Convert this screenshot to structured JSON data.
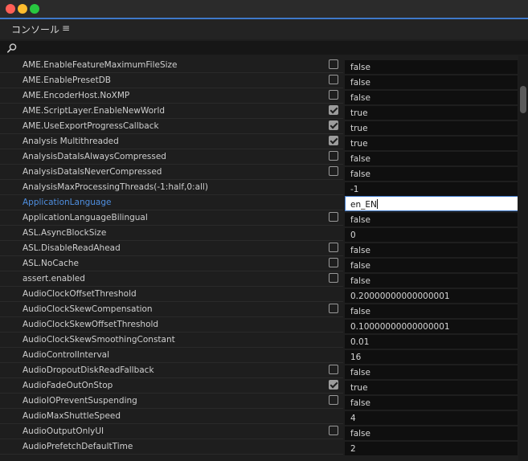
{
  "window": {
    "traffic_lights": [
      "close",
      "minimize",
      "maximize"
    ],
    "colors": {
      "close": "#ff5f57",
      "minimize": "#febc2e",
      "maximize": "#28c840",
      "accent": "#3f79c9",
      "selected_text": "#4f8fe0"
    }
  },
  "panel": {
    "title": "コンソール",
    "menu_icon": "hamburger-menu-icon",
    "menu_glyph": "≡"
  },
  "search": {
    "icon": "search-icon",
    "value": "",
    "placeholder": ""
  },
  "rows": [
    {
      "name": "AME.EnableFeatureMaximumFileSize",
      "type": "bool",
      "checked": false,
      "value": "false"
    },
    {
      "name": "AME.EnablePresetDB",
      "type": "bool",
      "checked": false,
      "value": "false"
    },
    {
      "name": "AME.EncoderHost.NoXMP",
      "type": "bool",
      "checked": false,
      "value": "false"
    },
    {
      "name": "AME.ScriptLayer.EnableNewWorld",
      "type": "bool",
      "checked": true,
      "value": "true"
    },
    {
      "name": "AME.UseExportProgressCallback",
      "type": "bool",
      "checked": true,
      "value": "true"
    },
    {
      "name": "Analysis Multithreaded",
      "type": "bool",
      "checked": true,
      "value": "true"
    },
    {
      "name": "AnalysisDataIsAlwaysCompressed",
      "type": "bool",
      "checked": false,
      "value": "false"
    },
    {
      "name": "AnalysisDataIsNeverCompressed",
      "type": "bool",
      "checked": false,
      "value": "false"
    },
    {
      "name": "AnalysisMaxProcessingThreads(-1:half,0:all)",
      "type": "text",
      "value": "-1"
    },
    {
      "name": "ApplicationLanguage",
      "type": "text",
      "value": "en_EN",
      "selected": true,
      "editing": true
    },
    {
      "name": "ApplicationLanguageBilingual",
      "type": "bool",
      "checked": false,
      "value": "false"
    },
    {
      "name": "ASL.AsyncBlockSize",
      "type": "text",
      "value": "0"
    },
    {
      "name": "ASL.DisableReadAhead",
      "type": "bool",
      "checked": false,
      "value": "false"
    },
    {
      "name": "ASL.NoCache",
      "type": "bool",
      "checked": false,
      "value": "false"
    },
    {
      "name": "assert.enabled",
      "type": "bool",
      "checked": false,
      "value": "false"
    },
    {
      "name": "AudioClockOffsetThreshold",
      "type": "text",
      "value": "0.20000000000000001"
    },
    {
      "name": "AudioClockSkewCompensation",
      "type": "bool",
      "checked": false,
      "value": "false"
    },
    {
      "name": "AudioClockSkewOffsetThreshold",
      "type": "text",
      "value": "0.10000000000000001"
    },
    {
      "name": "AudioClockSkewSmoothingConstant",
      "type": "text",
      "value": "0.01"
    },
    {
      "name": "AudioControlInterval",
      "type": "text",
      "value": "16"
    },
    {
      "name": "AudioDropoutDiskReadFallback",
      "type": "bool",
      "checked": false,
      "value": "false"
    },
    {
      "name": "AudioFadeOutOnStop",
      "type": "bool",
      "checked": true,
      "value": "true"
    },
    {
      "name": "AudioIOPreventSuspending",
      "type": "bool",
      "checked": false,
      "value": "false"
    },
    {
      "name": "AudioMaxShuttleSpeed",
      "type": "text",
      "value": "4"
    },
    {
      "name": "AudioOutputOnlyUI",
      "type": "bool",
      "checked": false,
      "value": "false"
    },
    {
      "name": "AudioPrefetchDefaultTime",
      "type": "text",
      "value": "2"
    }
  ]
}
